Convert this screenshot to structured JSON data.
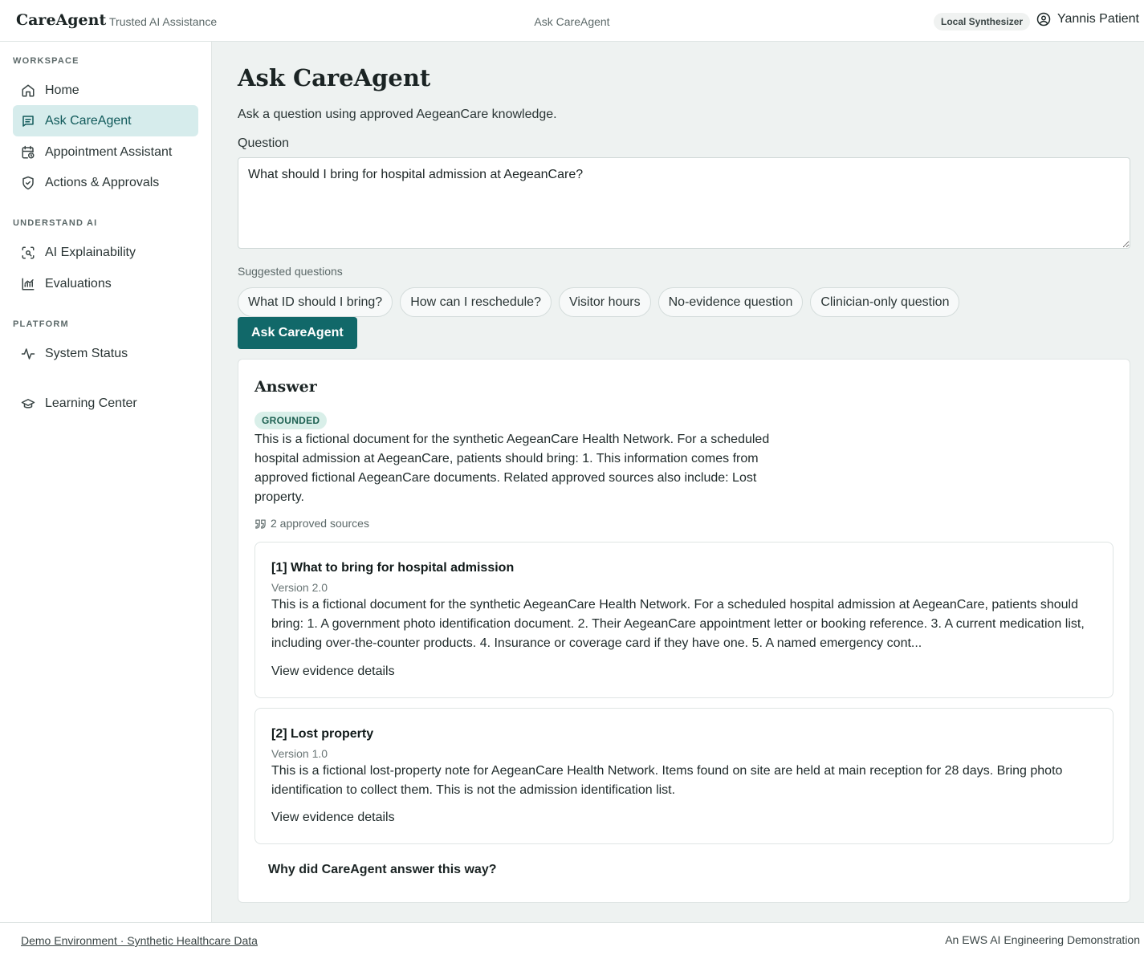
{
  "topbar": {
    "brand": "CareAgent",
    "brand_sub": "Trusted AI Assistance",
    "center_title": "Ask CareAgent",
    "model_badge": "Local Synthesizer",
    "user_name": "Yannis Patient"
  },
  "sidebar": {
    "sections": [
      {
        "label": "WORKSPACE"
      },
      {
        "label": "UNDERSTAND AI"
      },
      {
        "label": "PLATFORM"
      }
    ],
    "items": [
      {
        "label": "Home",
        "icon": "home-icon"
      },
      {
        "label": "Ask CareAgent",
        "icon": "chat-icon",
        "active": true
      },
      {
        "label": "Appointment Assistant",
        "icon": "calendar-clock-icon"
      },
      {
        "label": "Actions & Approvals",
        "icon": "shield-check-icon"
      },
      {
        "label": "AI Explainability",
        "icon": "scan-icon"
      },
      {
        "label": "Evaluations",
        "icon": "bar-chart-icon"
      },
      {
        "label": "System Status",
        "icon": "pulse-icon"
      },
      {
        "label": "Learning Center",
        "icon": "graduation-cap-icon"
      }
    ]
  },
  "main": {
    "title": "Ask CareAgent",
    "subtitle": "Ask a question using approved AegeanCare knowledge.",
    "question_label": "Question",
    "question_value": "What should I bring for hospital admission at AegeanCare?",
    "suggested_label": "Suggested questions",
    "suggestions": [
      "What ID should I bring?",
      "How can I reschedule?",
      "Visitor hours",
      "No-evidence question",
      "Clinician-only question"
    ],
    "ask_button": "Ask CareAgent"
  },
  "answer": {
    "title": "Answer",
    "badge": "GROUNDED",
    "text": "This is a fictional document for the synthetic AegeanCare Health Network. For a scheduled hospital admission at AegeanCare, patients should bring: 1. This information comes from approved fictional AegeanCare documents. Related approved sources also include: Lost property.",
    "sources_count": "2 approved sources",
    "sources": [
      {
        "title": "[1] What to bring for hospital admission",
        "version": "Version 2.0",
        "text": "This is a fictional document for the synthetic AegeanCare Health Network. For a scheduled hospital admission at AegeanCare, patients should bring: 1. A government photo identification document. 2. Their AegeanCare appointment letter or booking reference. 3. A current medication list, including over-the-counter products. 4. Insurance or coverage card if they have one. 5. A named emergency cont...",
        "link": "View evidence details"
      },
      {
        "title": "[2] Lost property",
        "version": "Version 1.0",
        "text": "This is a fictional lost-property note for AegeanCare Health Network. Items found on site are held at main reception for 28 days. Bring photo identification to collect them. This is not the admission identification list.",
        "link": "View evidence details"
      }
    ],
    "why_label": "Why did CareAgent answer this way?"
  },
  "footer": {
    "left": "Demo Environment · Synthetic Healthcare Data",
    "right": "An EWS AI Engineering Demonstration"
  },
  "colors": {
    "accent": "#116869",
    "active_nav_bg": "#d6ecec",
    "grounded_bg": "#d9efe9",
    "page_bg": "#eef2f1"
  }
}
